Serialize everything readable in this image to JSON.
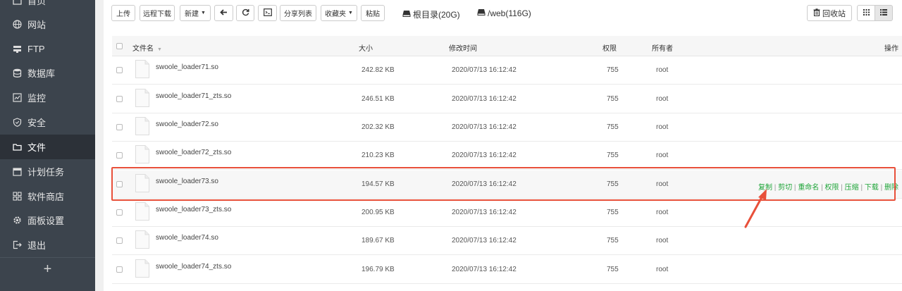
{
  "sidebar": {
    "items": [
      {
        "label": "首页",
        "icon": "home-icon"
      },
      {
        "label": "网站",
        "icon": "globe-icon"
      },
      {
        "label": "FTP",
        "icon": "ftp-icon"
      },
      {
        "label": "数据库",
        "icon": "database-icon"
      },
      {
        "label": "监控",
        "icon": "monitor-icon"
      },
      {
        "label": "安全",
        "icon": "shield-icon"
      },
      {
        "label": "文件",
        "icon": "folder-icon",
        "active": true
      },
      {
        "label": "计划任务",
        "icon": "calendar-icon"
      },
      {
        "label": "软件商店",
        "icon": "grid-icon"
      },
      {
        "label": "面板设置",
        "icon": "gear-icon"
      },
      {
        "label": "退出",
        "icon": "logout-icon"
      }
    ],
    "add_label": "+"
  },
  "toolbar": {
    "upload": "上传",
    "remote_download": "远程下载",
    "new": "新建",
    "back_icon": "back-arrow-icon",
    "refresh_icon": "refresh-icon",
    "terminal_icon": "terminal-icon",
    "share_list": "分享列表",
    "favorites": "收藏夹",
    "paste": "粘贴",
    "disk_root": "根目录(20G)",
    "disk_web": "/web(116G)",
    "recycle_bin": "回收站"
  },
  "table": {
    "headers": {
      "name": "文件名",
      "size": "大小",
      "mtime": "修改时间",
      "perm": "权限",
      "owner": "所有者",
      "ops": "操作"
    },
    "rows": [
      {
        "name": "swoole_loader71.so",
        "size": "242.82 KB",
        "mtime": "2020/07/13 16:12:42",
        "perm": "755",
        "owner": "root"
      },
      {
        "name": "swoole_loader71_zts.so",
        "size": "246.51 KB",
        "mtime": "2020/07/13 16:12:42",
        "perm": "755",
        "owner": "root"
      },
      {
        "name": "swoole_loader72.so",
        "size": "202.32 KB",
        "mtime": "2020/07/13 16:12:42",
        "perm": "755",
        "owner": "root"
      },
      {
        "name": "swoole_loader72_zts.so",
        "size": "210.23 KB",
        "mtime": "2020/07/13 16:12:42",
        "perm": "755",
        "owner": "root"
      },
      {
        "name": "swoole_loader73.so",
        "size": "194.57 KB",
        "mtime": "2020/07/13 16:12:42",
        "perm": "755",
        "owner": "root"
      },
      {
        "name": "swoole_loader73_zts.so",
        "size": "200.95 KB",
        "mtime": "2020/07/13 16:12:42",
        "perm": "755",
        "owner": "root"
      },
      {
        "name": "swoole_loader74.so",
        "size": "189.67 KB",
        "mtime": "2020/07/13 16:12:42",
        "perm": "755",
        "owner": "root"
      },
      {
        "name": "swoole_loader74_zts.so",
        "size": "196.79 KB",
        "mtime": "2020/07/13 16:12:42",
        "perm": "755",
        "owner": "root"
      }
    ],
    "row_actions": {
      "copy": "复制",
      "cut": "剪切",
      "rename": "重命名",
      "permission": "权限",
      "compress": "压缩",
      "download": "下载",
      "delete": "删除",
      "separator": "|"
    }
  },
  "colors": {
    "sidebar_bg": "#3c444d",
    "sidebar_active": "#2c3138",
    "action_link": "#20a53a",
    "highlight_border": "#e8503a"
  }
}
